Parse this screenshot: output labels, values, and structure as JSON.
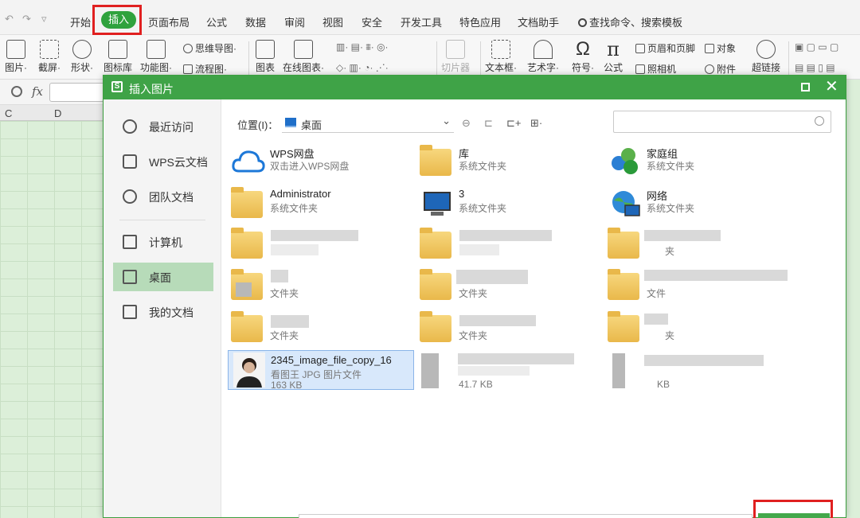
{
  "menubar": {
    "tabs": [
      "开始",
      "插入",
      "页面布局",
      "公式",
      "数据",
      "审阅",
      "视图",
      "安全",
      "开发工具",
      "特色应用",
      "文档助手"
    ],
    "active_tab": "插入",
    "search_label": "查找命令、搜索模板"
  },
  "toolbar": {
    "big": [
      {
        "label": "图片·",
        "icon": "picture-icon"
      },
      {
        "label": "截屏·",
        "icon": "screenshot-icon"
      },
      {
        "label": "形状·",
        "icon": "shapes-icon"
      },
      {
        "label": "图标库",
        "icon": "icon-library-icon"
      },
      {
        "label": "功能图·",
        "icon": "function-chart-icon"
      },
      {
        "label": "图表",
        "icon": "chart-icon"
      },
      {
        "label": "在线图表·",
        "icon": "online-chart-icon"
      },
      {
        "label": "切片器",
        "icon": "slicer-icon"
      },
      {
        "label": "文本框·",
        "icon": "textbox-icon"
      },
      {
        "label": "艺术字·",
        "icon": "wordart-icon"
      },
      {
        "label": "符号·",
        "icon": "omega-icon"
      },
      {
        "label": "公式",
        "icon": "pi-icon"
      },
      {
        "label": "超链接",
        "icon": "link-icon"
      }
    ],
    "small": [
      {
        "label": "思维导图·",
        "icon": "mindmap-icon"
      },
      {
        "label": "流程图·",
        "icon": "flowchart-icon"
      },
      {
        "label": "页眉和页脚",
        "icon": "header-footer-icon"
      },
      {
        "label": "对象",
        "icon": "object-icon"
      },
      {
        "label": "照相机",
        "icon": "camera-icon"
      },
      {
        "label": "附件",
        "icon": "attachment-icon"
      }
    ]
  },
  "sheet": {
    "columns": [
      "C",
      "D"
    ]
  },
  "dialog": {
    "title": "插入图片",
    "sidebar": [
      {
        "label": "最近访问",
        "icon": "clock-icon"
      },
      {
        "label": "WPS云文档",
        "icon": "cloud-box-icon"
      },
      {
        "label": "团队文档",
        "icon": "team-icon"
      },
      {
        "label": "计算机",
        "icon": "computer-icon"
      },
      {
        "label": "桌面",
        "icon": "desktop-icon",
        "active": true
      },
      {
        "label": "我的文档",
        "icon": "my-documents-icon"
      }
    ],
    "location_label": "位置(I)：",
    "location_value": "桌面",
    "search_placeholder": "",
    "files": [
      {
        "name": "WPS网盘",
        "desc": "双击进入WPS网盘",
        "icon": "cloud-icon"
      },
      {
        "name": "库",
        "desc": "系统文件夹",
        "icon": "library-folder-icon"
      },
      {
        "name": "家庭组",
        "desc": "系统文件夹",
        "icon": "homegroup-icon"
      },
      {
        "name": "Administrator",
        "desc": "系统文件夹",
        "icon": "user-folder-icon"
      },
      {
        "name": "3",
        "desc": "系统文件夹",
        "icon": "computer-icon"
      },
      {
        "name": "网络",
        "desc": "系统文件夹",
        "icon": "network-icon"
      }
    ],
    "partial_texts": [
      "文件夹",
      "文件夹",
      "文件夹",
      "夹",
      "文件夹",
      "文件",
      "夹",
      "41.7 KB",
      "KB"
    ],
    "selected_file": {
      "name": "2345_image_file_copy_16",
      "desc": "看图王 JPG 图片文件",
      "size": "163 KB"
    }
  }
}
